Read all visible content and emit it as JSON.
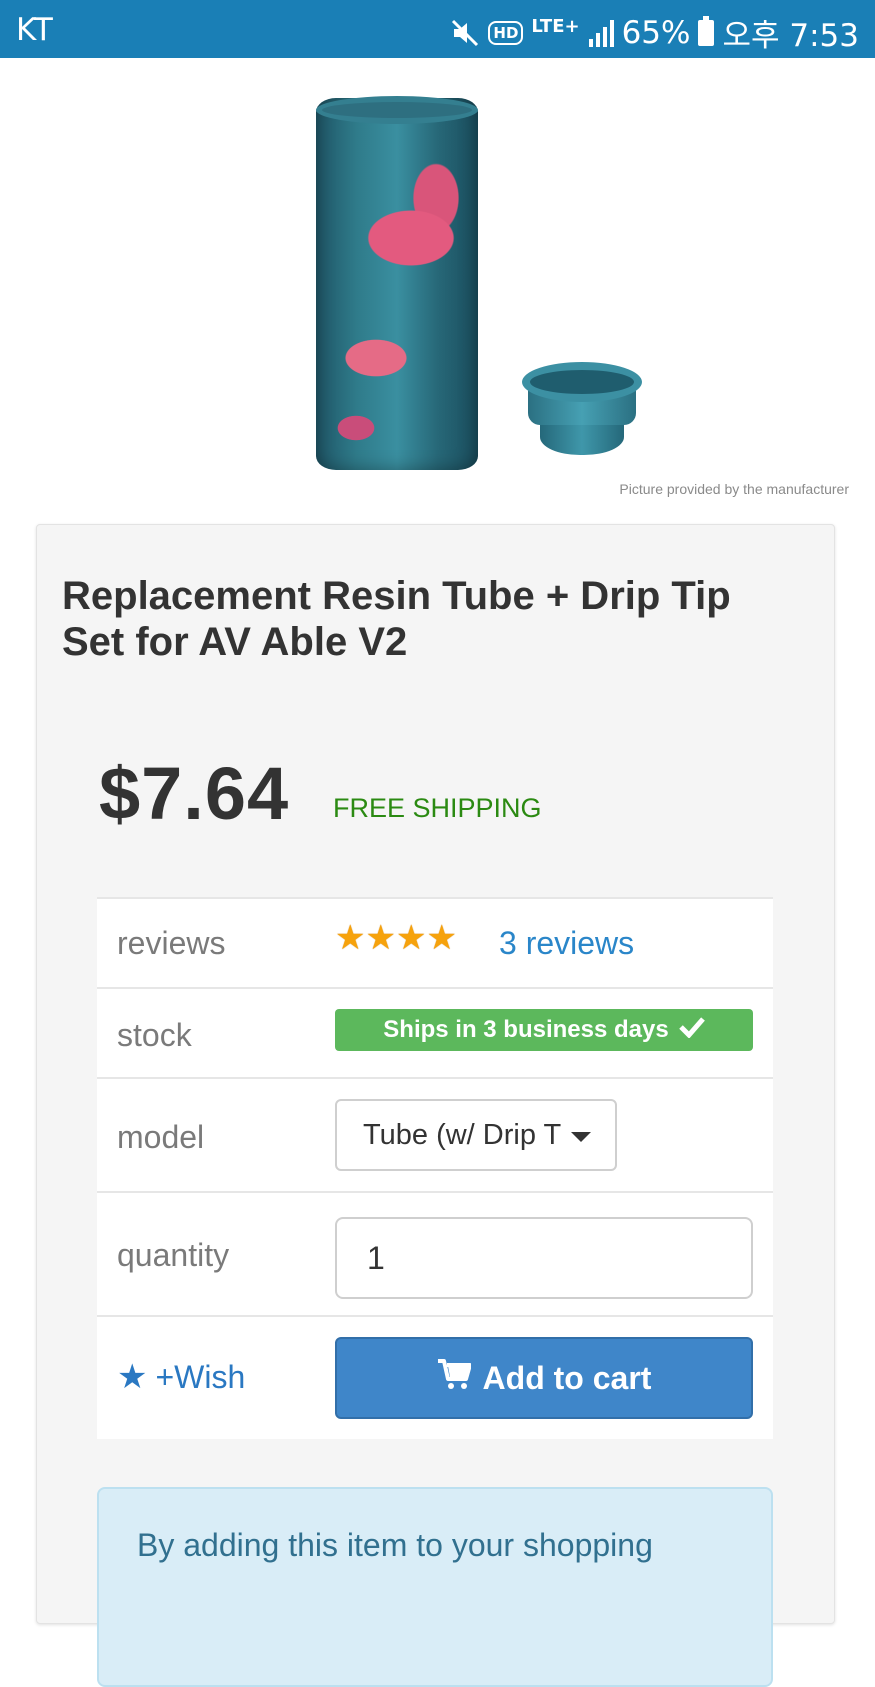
{
  "status_bar": {
    "carrier": "KT",
    "battery": "65%",
    "time": "오후 7:53",
    "icons": [
      "mute-icon",
      "hd-icon",
      "lte-icon",
      "signal-icon",
      "battery-icon"
    ],
    "hd_label": "HD",
    "lte_label": "LTE+"
  },
  "product_image": {
    "caption": "Picture provided by the manufacturer"
  },
  "product": {
    "title": "Replacement Resin Tube + Drip Tip Set for AV Able V2",
    "price": "$7.64",
    "shipping": "FREE SHIPPING"
  },
  "specs": {
    "reviews_label": "reviews",
    "rating_stars": 4,
    "reviews_link": "3 reviews",
    "stock_label": "stock",
    "stock_badge": "Ships in 3 business days",
    "model_label": "model",
    "model_value": "Tube (w/ Drip T",
    "quantity_label": "quantity",
    "quantity_value": "1"
  },
  "actions": {
    "wish_label": "+Wish",
    "add_to_cart": "Add to cart"
  },
  "notice": {
    "text": "By adding this item to your shopping"
  },
  "colors": {
    "status_bar": "#1a7fb6",
    "accent_blue": "#3f86c9",
    "stock_green": "#5cb85c",
    "shipping_green": "#2b8a12",
    "star_orange": "#f6a20c"
  }
}
